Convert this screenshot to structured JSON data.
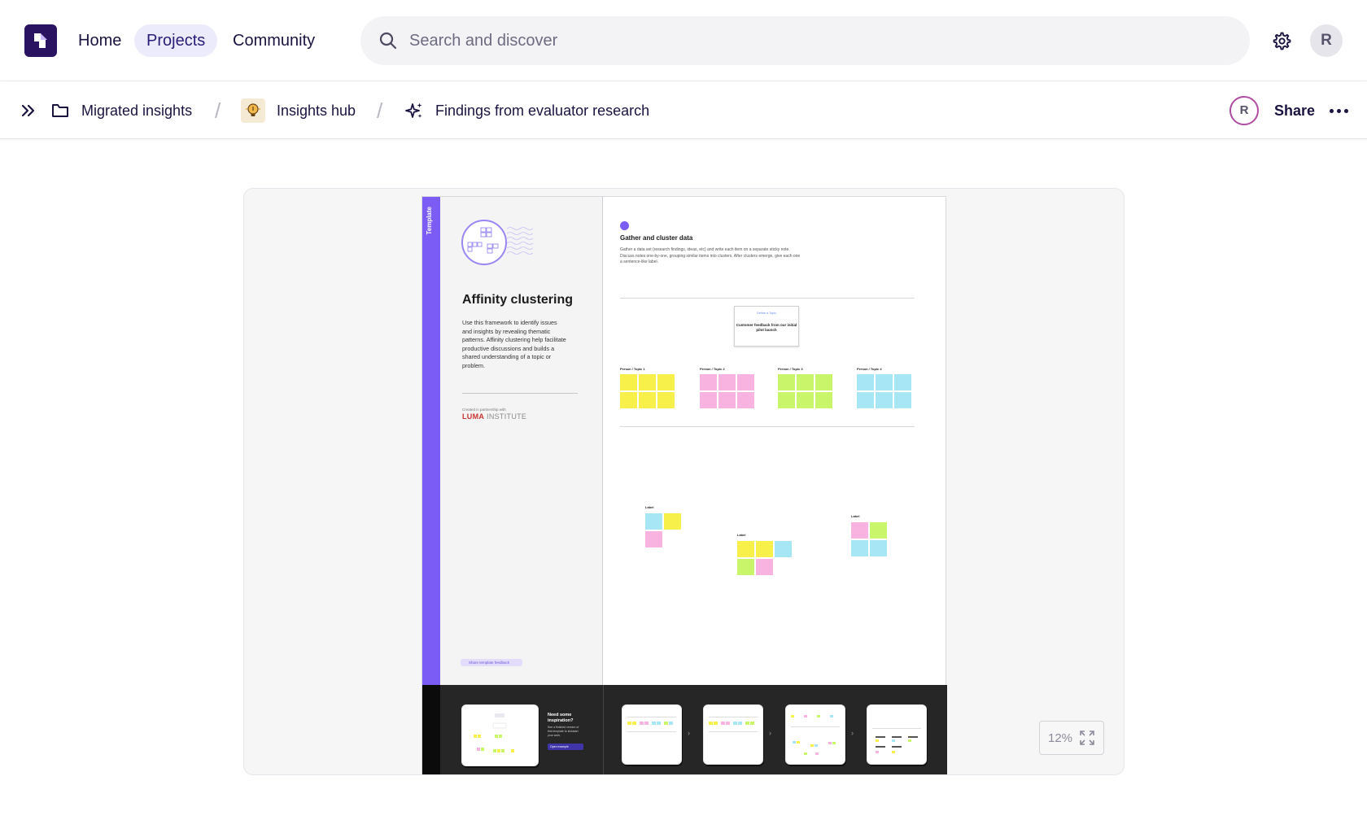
{
  "nav": {
    "logo_icon": "app-logo-icon",
    "links": [
      {
        "label": "Home",
        "active": false
      },
      {
        "label": "Projects",
        "active": true
      },
      {
        "label": "Community",
        "active": false
      }
    ],
    "search_placeholder": "Search and discover",
    "settings_icon": "gear-icon",
    "user_initial": "R"
  },
  "breadcrumb": {
    "expand_icon": "double-chevron-right-icon",
    "items": [
      {
        "label": "Migrated insights",
        "icon": "folder-icon"
      },
      {
        "label": "Insights hub",
        "icon": "lightbulb-icon"
      },
      {
        "label": "Findings from evaluator research",
        "icon": "sparkles-icon"
      }
    ],
    "separator": "/",
    "collaborator_initial": "R",
    "share_label": "Share",
    "more_icon": "more-horizontal-icon"
  },
  "preview": {
    "strip_label": "Template",
    "left": {
      "title": "Affinity clustering",
      "description": "Use this framework to identify issues and insights by revealing thematic patterns. Affinity clustering help facilitate productive discussions and builds a shared understanding of a topic or problem.",
      "partner_note": "Created in partnership with",
      "partner_brand": "LUMA",
      "partner_suffix": "INSTITUTE",
      "feedback_button": "Share template feedback"
    },
    "right": {
      "step_title": "Gather and cluster data",
      "step_description": "Gather a data set (research findings, ideas, etc) and write each item on a separate sticky note. Discuss notes one-by-one, grouping similar items into clusters. After clusters emerge, give each one a sentence-like label.",
      "card_kicker": "Define a Topic",
      "card_text": "Customer feedback from our initial pilot launch",
      "groups": [
        "Person / Topic 1",
        "Person / Topic 2",
        "Person / Topic 3",
        "Person / Topic 4"
      ],
      "cluster_label": "Label"
    },
    "bottom": {
      "inspiration_title": "Need some inspiration?",
      "inspiration_text": "See a finished version of this template to kickstart your work.",
      "inspiration_button": "Open example"
    },
    "zoom_level": "12%",
    "fullscreen_icon": "expand-icon"
  },
  "colors": {
    "brand": "#2a1361",
    "accent": "#7b5cf5",
    "sticky_yellow": "#f8f04a",
    "sticky_pink": "#f9b3e0",
    "sticky_green": "#c8f56a",
    "sticky_blue": "#a7e6f5"
  }
}
